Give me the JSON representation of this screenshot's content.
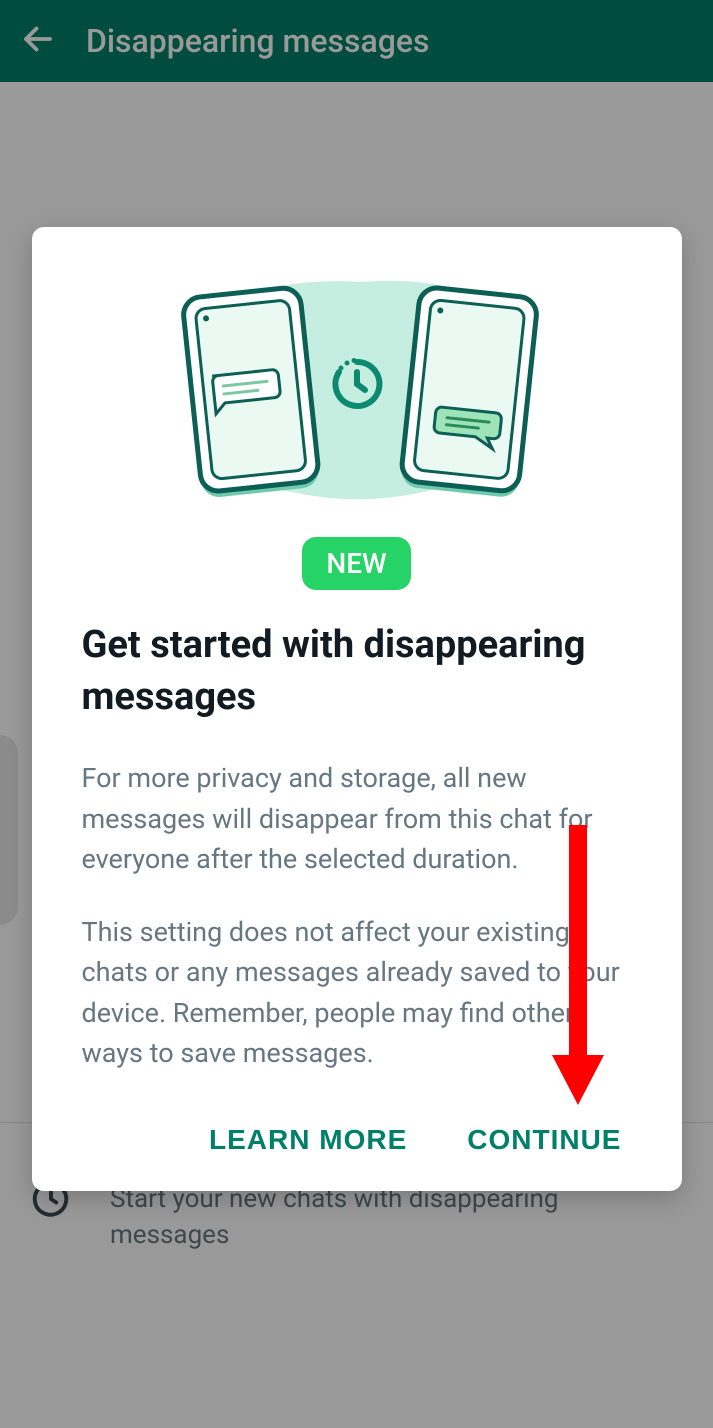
{
  "header": {
    "title": "Disappearing messages"
  },
  "background": {
    "option_subtitle": "Start your new chats with disappearing messages"
  },
  "dialog": {
    "new_badge": "NEW",
    "title": "Get started with disappearing messages",
    "paragraph1": "For more privacy and storage, all new messages will disappear from this chat for everyone after the selected duration.",
    "paragraph2": "This setting does not affect your existing chats or any messages already saved to your device. Remember, people may find other ways to save messages.",
    "learn_more": "LEARN MORE",
    "continue": "CONTINUE"
  }
}
